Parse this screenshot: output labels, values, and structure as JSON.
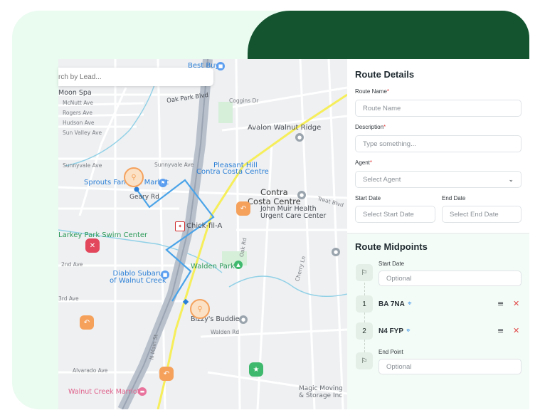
{
  "map": {
    "search_placeholder": "rch by Lead...",
    "labels": {
      "best_buy": "Best Buy",
      "moon_spa": "Moon Spa",
      "mcnutt": "McNutt Ave",
      "rogers": "Rogers Ave",
      "hudson": "Hudson Ave",
      "sun_valley": "Sun Valley Ave",
      "oak_park": "Oak Park Blvd",
      "coggins": "Coggins Dr",
      "avalon": "Avalon Walnut Ridge",
      "sunnyvale1": "Sunnyvale Ave",
      "sunnyvale2": "Sunnyvale Ave",
      "pleasant_hill": "Pleasant Hill",
      "ccc_station": "Contra Costa Centre",
      "sprouts": "Sprouts Farmers Market",
      "geary": "Geary Rd",
      "contra_costa_centre": "Contra\nCosta Centre",
      "treat_blvd": "Treat Blvd",
      "john_muir": "John Muir Health\nUrgent Care Center",
      "chick": "Chick-fil-A",
      "larkey": "Larkey Park Swim Center",
      "oak_rd": "Oak Rd",
      "cherry": "Cherry Ln",
      "second_ave": "2nd Ave",
      "diablo": "Diablo Subaru\nof Walnut Creek",
      "walden_park": "Walden Park",
      "third_ave": "3rd Ave",
      "bizzys": "Bizzy's Buddies",
      "walden_rd": "Walden Rd",
      "n_main": "N Main St",
      "alvarado": "Alvarado Ave",
      "walnut_marriott": "Walnut Creek Marriott",
      "magic_moving": "Magic Moving\n& Storage Inc"
    }
  },
  "panel": {
    "route_details_title": "Route Details",
    "route_name_label": "Route Name",
    "route_name_placeholder": "Route Name",
    "description_label": "Description",
    "description_placeholder": "Type something...",
    "agent_label": "Agent",
    "agent_placeholder": "Select Agent",
    "start_date_label": "Start Date",
    "start_date_placeholder": "Select Start Date",
    "end_date_label": "End Date",
    "end_date_placeholder": "Select End Date",
    "required_mark": "*",
    "midpoints_title": "Route Midpoints",
    "start_label": "Start Date",
    "start_placeholder": "Optional",
    "midpoints": [
      {
        "index": "1",
        "name": "BA 7NA"
      },
      {
        "index": "2",
        "name": "N4 FYP"
      }
    ],
    "end_label": "End Point",
    "end_placeholder": "Optional"
  },
  "colors": {
    "brand_dark": "#145530",
    "brand_light": "#eafbf0",
    "route_line": "#4aa3e8",
    "highway": "#f6ee5a",
    "pin_orange": "#f5a15c",
    "pin_red": "#e2475b",
    "pin_green": "#3fb96d"
  },
  "icons": [
    "search-icon",
    "flag-icon",
    "target-icon",
    "drag-handle-icon",
    "close-icon",
    "chevron-down-icon",
    "location-pin-icon"
  ]
}
